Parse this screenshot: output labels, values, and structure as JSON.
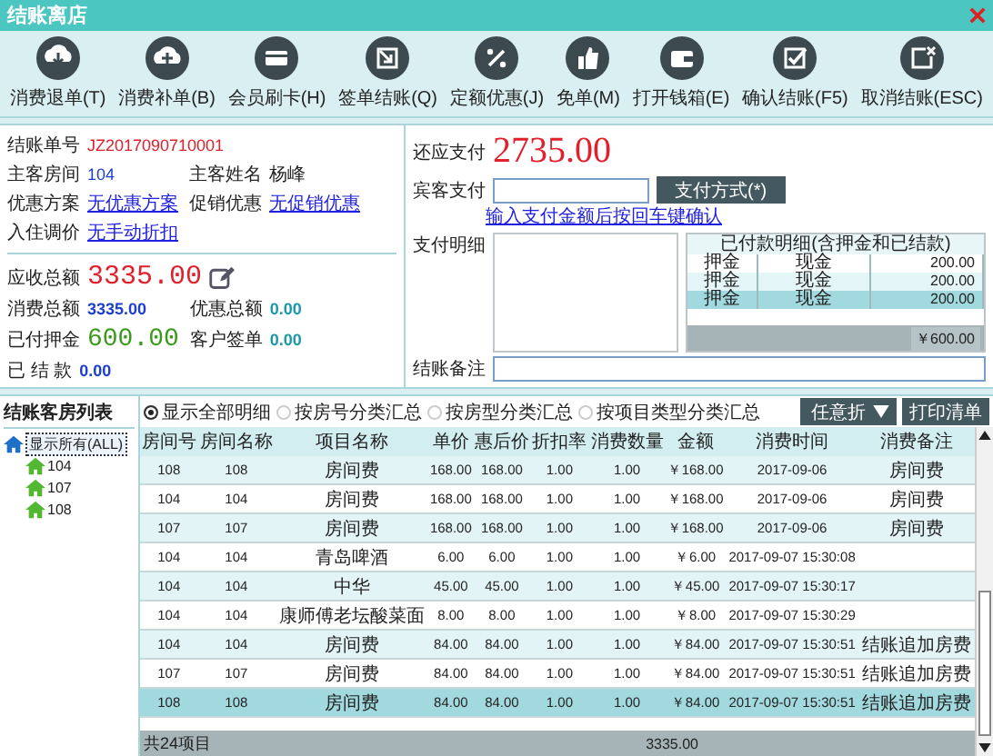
{
  "window": {
    "title": "结账离店"
  },
  "toolbar": [
    {
      "label": "消费退单(T)"
    },
    {
      "label": "消费补单(B)"
    },
    {
      "label": "会员刷卡(H)"
    },
    {
      "label": "签单结账(Q)"
    },
    {
      "label": "定额优惠(J)"
    },
    {
      "label": "免单(M)"
    },
    {
      "label": "打开钱箱(E)"
    },
    {
      "label": "确认结账(F5)"
    },
    {
      "label": "取消结账(ESC)"
    }
  ],
  "bill": {
    "bill_no": {
      "label": "结账单号",
      "value": "JZ2017090710001"
    },
    "room": {
      "label": "主客房间",
      "value": "104"
    },
    "guest_name": {
      "label": "主客姓名",
      "value": "杨峰"
    },
    "discount_plan": {
      "label": "优惠方案",
      "value": "无优惠方案"
    },
    "promotion": {
      "label": "促销优惠",
      "value": "无促销优惠"
    },
    "price_adjust": {
      "label": "入住调价",
      "value": "无手动折扣"
    },
    "receivable": {
      "label": "应收总额",
      "value": "3335.00"
    },
    "consumption": {
      "label": "消费总额",
      "value": "3335.00"
    },
    "discount_total": {
      "label": "优惠总额",
      "value": "0.00"
    },
    "deposit": {
      "label": "已付押金",
      "value": "600.00"
    },
    "signed": {
      "label": "客户签单",
      "value": "0.00"
    },
    "settled": {
      "label": "已 结 款",
      "value": "0.00"
    }
  },
  "payment": {
    "due": {
      "label": "还应支付",
      "value": "2735.00"
    },
    "guest_pay": {
      "label": "宾客支付"
    },
    "method_button": "支付方式(*)",
    "hint": "输入支付金额后按回车键确认",
    "detail_label": "支付明细",
    "paid_table": {
      "title": "已付款明细(含押金和已结款)",
      "rows": [
        {
          "type": "押金",
          "method": "现金",
          "amount": "200.00",
          "selected": false
        },
        {
          "type": "押金",
          "method": "现金",
          "amount": "200.00",
          "selected": false
        },
        {
          "type": "押金",
          "method": "现金",
          "amount": "200.00",
          "selected": true
        }
      ],
      "total": "￥600.00"
    },
    "note_label": "结账备注"
  },
  "room_list": {
    "title": "结账客房列表",
    "items": [
      {
        "label": "显示所有(ALL)",
        "selected": true,
        "children": [
          {
            "label": "104",
            "selected": false
          },
          {
            "label": "107",
            "selected": false
          },
          {
            "label": "108",
            "selected": false
          }
        ]
      }
    ]
  },
  "view_options": [
    {
      "label": "显示全部明细",
      "selected": true
    },
    {
      "label": "按房号分类汇总",
      "selected": false
    },
    {
      "label": "按房型分类汇总",
      "selected": false
    },
    {
      "label": "按项目类型分类汇总",
      "selected": false
    }
  ],
  "discount_dropdown": "任意折",
  "print_button": "打印清单",
  "table": {
    "columns": [
      "房间号",
      "房间名称",
      "项目名称",
      "单价",
      "惠后价",
      "折扣率",
      "消费数量",
      "金额",
      "消费时间",
      "消费备注"
    ],
    "rows": [
      {
        "cells": [
          "108",
          "108",
          "房间费",
          "168.00",
          "168.00",
          "1.00",
          "1.00",
          "￥168.00",
          "2017-09-06",
          "房间费"
        ],
        "selected": false
      },
      {
        "cells": [
          "104",
          "104",
          "房间费",
          "168.00",
          "168.00",
          "1.00",
          "1.00",
          "￥168.00",
          "2017-09-06",
          "房间费"
        ],
        "selected": false
      },
      {
        "cells": [
          "107",
          "107",
          "房间费",
          "168.00",
          "168.00",
          "1.00",
          "1.00",
          "￥168.00",
          "2017-09-06",
          "房间费"
        ],
        "selected": false
      },
      {
        "cells": [
          "104",
          "104",
          "青岛啤酒",
          "6.00",
          "6.00",
          "1.00",
          "1.00",
          "￥6.00",
          "2017-09-07 15:30:08",
          ""
        ],
        "selected": false
      },
      {
        "cells": [
          "104",
          "104",
          "中华",
          "45.00",
          "45.00",
          "1.00",
          "1.00",
          "￥45.00",
          "2017-09-07 15:30:17",
          ""
        ],
        "selected": false
      },
      {
        "cells": [
          "104",
          "104",
          "康师傅老坛酸菜面",
          "8.00",
          "8.00",
          "1.00",
          "1.00",
          "￥8.00",
          "2017-09-07 15:30:29",
          ""
        ],
        "selected": false
      },
      {
        "cells": [
          "104",
          "104",
          "房间费",
          "84.00",
          "84.00",
          "1.00",
          "1.00",
          "￥84.00",
          "2017-09-07 15:30:51",
          "结账追加房费"
        ],
        "selected": false
      },
      {
        "cells": [
          "107",
          "107",
          "房间费",
          "84.00",
          "84.00",
          "1.00",
          "1.00",
          "￥84.00",
          "2017-09-07 15:30:51",
          "结账追加房费"
        ],
        "selected": false
      },
      {
        "cells": [
          "108",
          "108",
          "房间费",
          "84.00",
          "84.00",
          "1.00",
          "1.00",
          "￥84.00",
          "2017-09-07 15:30:51",
          "结账追加房费"
        ],
        "selected": true
      }
    ],
    "footer_count": "共24项目",
    "footer_total": "3335.00"
  }
}
